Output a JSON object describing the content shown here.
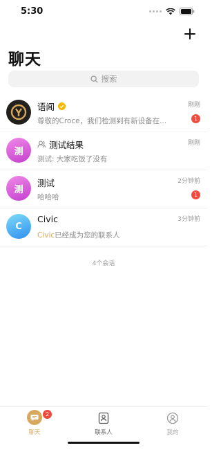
{
  "status_bar": {
    "time": "5:30"
  },
  "header": {
    "title": "聊天",
    "add_icon": "plus-icon"
  },
  "search": {
    "placeholder": "搜索",
    "icon": "search-icon"
  },
  "conversations": [
    {
      "name": "语闻",
      "preview": "尊敬的Croce，我们检测到有新设备在...",
      "time": "刚刚",
      "unread": "1",
      "avatar_text": "",
      "verified": true
    },
    {
      "name": "测试结果",
      "preview": "测试: 大家吃饭了没有",
      "time": "刚刚",
      "unread": "",
      "avatar_text": "测",
      "group": true
    },
    {
      "name": "测试",
      "preview": "哈哈哈",
      "time": "2分钟前",
      "unread": "1",
      "avatar_text": "测"
    },
    {
      "name": "Civic",
      "preview_highlight": "Civic",
      "preview_rest": "已经成为您的联系人",
      "time": "3分钟前",
      "unread": "",
      "avatar_text": "C"
    }
  ],
  "footer": {
    "count_text": "4个会话"
  },
  "tab_bar": {
    "tabs": [
      {
        "label": "聊天",
        "badge": "2",
        "icon": "chat-bubble-icon"
      },
      {
        "label": "联系人",
        "icon": "contacts-icon"
      },
      {
        "label": "我的",
        "icon": "profile-icon"
      }
    ]
  },
  "colors": {
    "accent": "#d7a85e",
    "badge": "#f04b3f",
    "verified": "#f5b800"
  }
}
